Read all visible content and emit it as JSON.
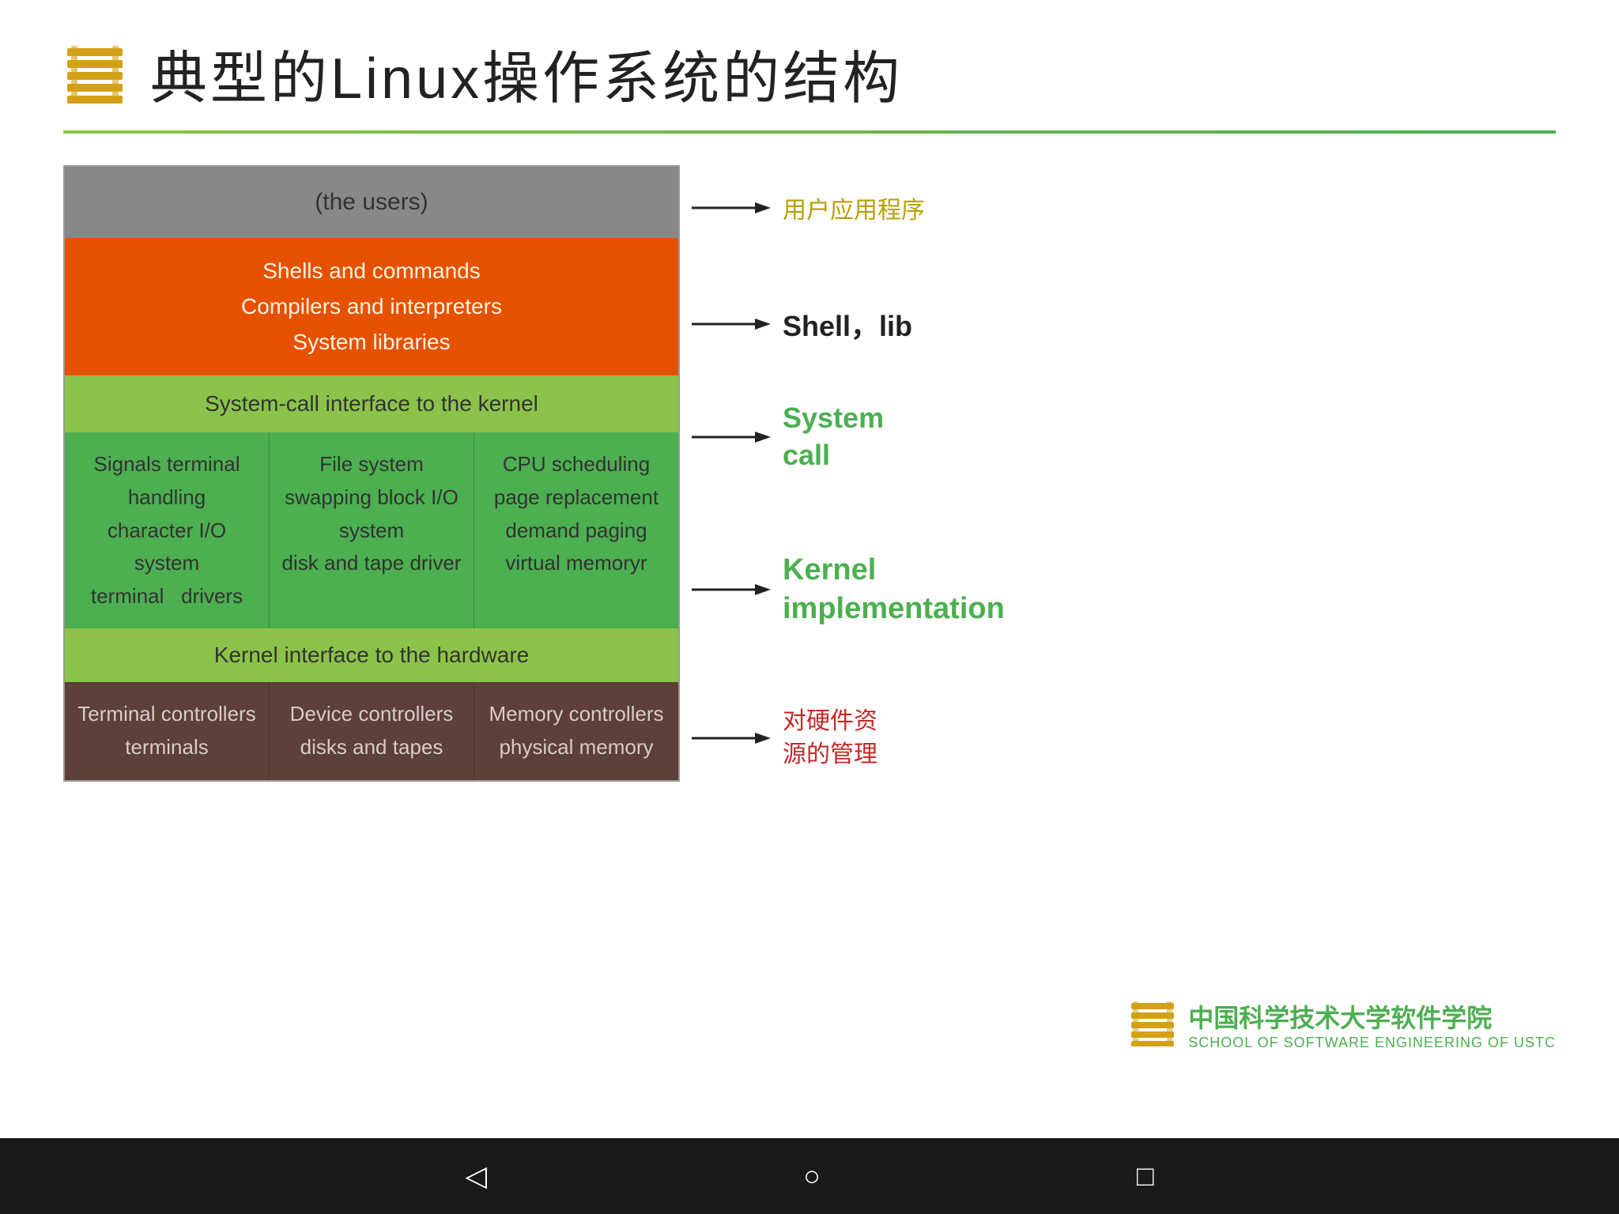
{
  "slide": {
    "title": "典型的Linux操作系统的结构",
    "divider_visible": true
  },
  "diagram": {
    "users_layer": "(the users)",
    "orange_layer": {
      "line1": "Shells and commands",
      "line2": "Compilers and interpreters",
      "line3": "System libraries"
    },
    "syscall_layer": "System-call interface to the kernel",
    "kernel_cells": [
      {
        "lines": [
          "Signals terminal",
          "handling",
          "character I/O system",
          "terminal    drivers"
        ]
      },
      {
        "lines": [
          "File system",
          "swapping block I/O",
          "system",
          "disk and tape driver"
        ]
      },
      {
        "lines": [
          "CPU scheduling",
          "page replacement",
          "demand paging",
          "virtual memoryr"
        ]
      }
    ],
    "hw_interface_layer": "Kernel interface to the hardware",
    "controller_cells": [
      {
        "lines": [
          "Terminal controllers",
          "terminals"
        ]
      },
      {
        "lines": [
          "Device controllers",
          "disks and tapes"
        ]
      },
      {
        "lines": [
          "Memory controllers",
          "physical memory"
        ]
      }
    ]
  },
  "annotations": {
    "users": "用户应用程序",
    "shell_lib": "Shell，lib",
    "system_call": "System\ncall",
    "kernel_impl": "Kernel\nimplementation",
    "hw_mgmt": "对硬件资\n源的管理"
  },
  "ustc": {
    "name": "中国科学技术大学软件学院",
    "sub": "SCHOOL OF SOFTWARE ENGINEERING OF USTC"
  },
  "navbar": {
    "back": "◁",
    "home": "○",
    "recent": "□"
  }
}
